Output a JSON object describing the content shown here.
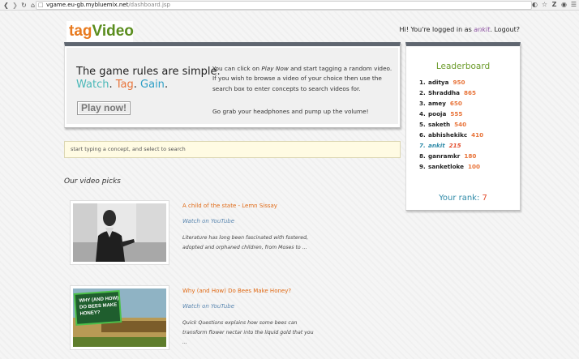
{
  "browser": {
    "url_host": "vgame.eu-gb.mybluemix.net",
    "url_path": "/dashboard.jsp"
  },
  "header": {
    "logo_part1": "tag",
    "logo_part2": "Video",
    "login_prefix": "Hi! You're logged in as ",
    "username": "ankit",
    "logout_label": "Logout?"
  },
  "hero": {
    "title": "The game rules are simple.",
    "sub_watch": "Watch",
    "sub_tag": "Tag",
    "sub_gain": "Gain",
    "play_label": "Play now!",
    "text_1": "You can click on ",
    "text_play": "Play Now",
    "text_2": " and start tagging a random video. If you wish to browse a video of your choice then use the search box to enter concepts to search videos for.",
    "text_3": "Go grab your headphones and pump up the volume!"
  },
  "search": {
    "placeholder": "start typing a concept, and select to search"
  },
  "picks": {
    "title": "Our video picks",
    "videos": [
      {
        "title": "A child of the state - Lemn Sissay",
        "link": "Watch on YouTube",
        "desc": "Literature has long been fascinated with fostered, adopted and orphaned children, from Moses to ..."
      },
      {
        "title": "Why (and How) Do Bees Make Honey?",
        "link": "Watch on YouTube",
        "desc": "Quick Questions explains how some bees can transform flower nectar into the liquid gold that you ...",
        "thumb_text": "WHY (AND HOW) DO BEES MAKE HONEY?"
      }
    ]
  },
  "leaderboard": {
    "title": "Leaderboard",
    "rows": [
      {
        "rank": "1.",
        "name": "aditya",
        "score": "950"
      },
      {
        "rank": "2.",
        "name": "Shraddha",
        "score": "865"
      },
      {
        "rank": "3.",
        "name": "amey",
        "score": "650"
      },
      {
        "rank": "4.",
        "name": "pooja",
        "score": "555"
      },
      {
        "rank": "5.",
        "name": "saketh",
        "score": "540"
      },
      {
        "rank": "6.",
        "name": "abhishekikc",
        "score": "410"
      },
      {
        "rank": "7.",
        "name": "ankit",
        "score": "215"
      },
      {
        "rank": "8.",
        "name": "ganramkr",
        "score": "180"
      },
      {
        "rank": "9.",
        "name": "sanketloke",
        "score": "100"
      }
    ],
    "your_rank_label": "Your rank: ",
    "your_rank_value": "7"
  },
  "colors": {
    "orange": "#e8743a",
    "green": "#6b9b2a",
    "teal": "#2f8aa8",
    "header_bar": "#5f6670"
  }
}
